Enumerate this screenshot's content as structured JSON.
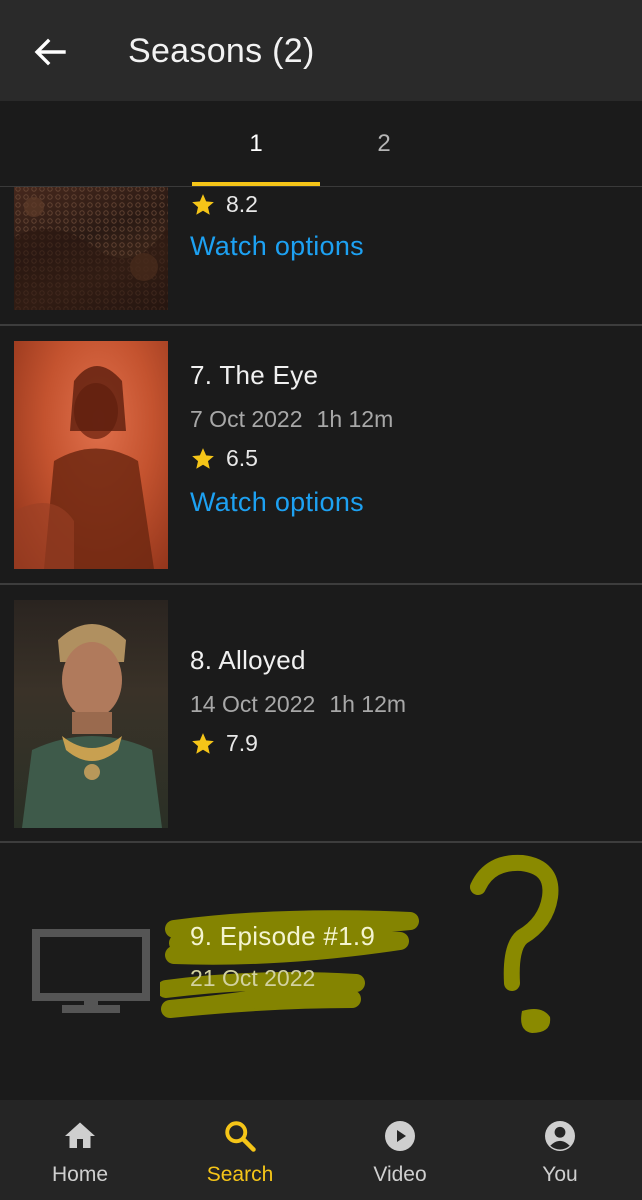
{
  "header": {
    "title": "Seasons (2)"
  },
  "tabs": [
    {
      "label": "1",
      "selected": true
    },
    {
      "label": "2",
      "selected": false
    }
  ],
  "episodes": [
    {
      "title": "",
      "date": "",
      "runtime": "",
      "rating": "8.2",
      "watch_label": "Watch options"
    },
    {
      "title": "7. The Eye",
      "date": "7 Oct 2022",
      "runtime": "1h 12m",
      "rating": "6.5",
      "watch_label": "Watch options"
    },
    {
      "title": "8. Alloyed",
      "date": "14 Oct 2022",
      "runtime": "1h 12m",
      "rating": "7.9"
    },
    {
      "title": "9. Episode #1.9",
      "date": "21 Oct 2022"
    }
  ],
  "bottom_nav": [
    {
      "label": "Home",
      "icon": "home-icon",
      "active": false
    },
    {
      "label": "Search",
      "icon": "search-icon",
      "active": true
    },
    {
      "label": "Video",
      "icon": "play-circle-icon",
      "active": false
    },
    {
      "label": "You",
      "icon": "account-icon",
      "active": false
    }
  ],
  "colors": {
    "accent": "#f5c518",
    "link": "#1da1f2",
    "background": "#1b1b1b",
    "appbar": "#2a2a2a",
    "highlighter": "#8a8a00"
  }
}
